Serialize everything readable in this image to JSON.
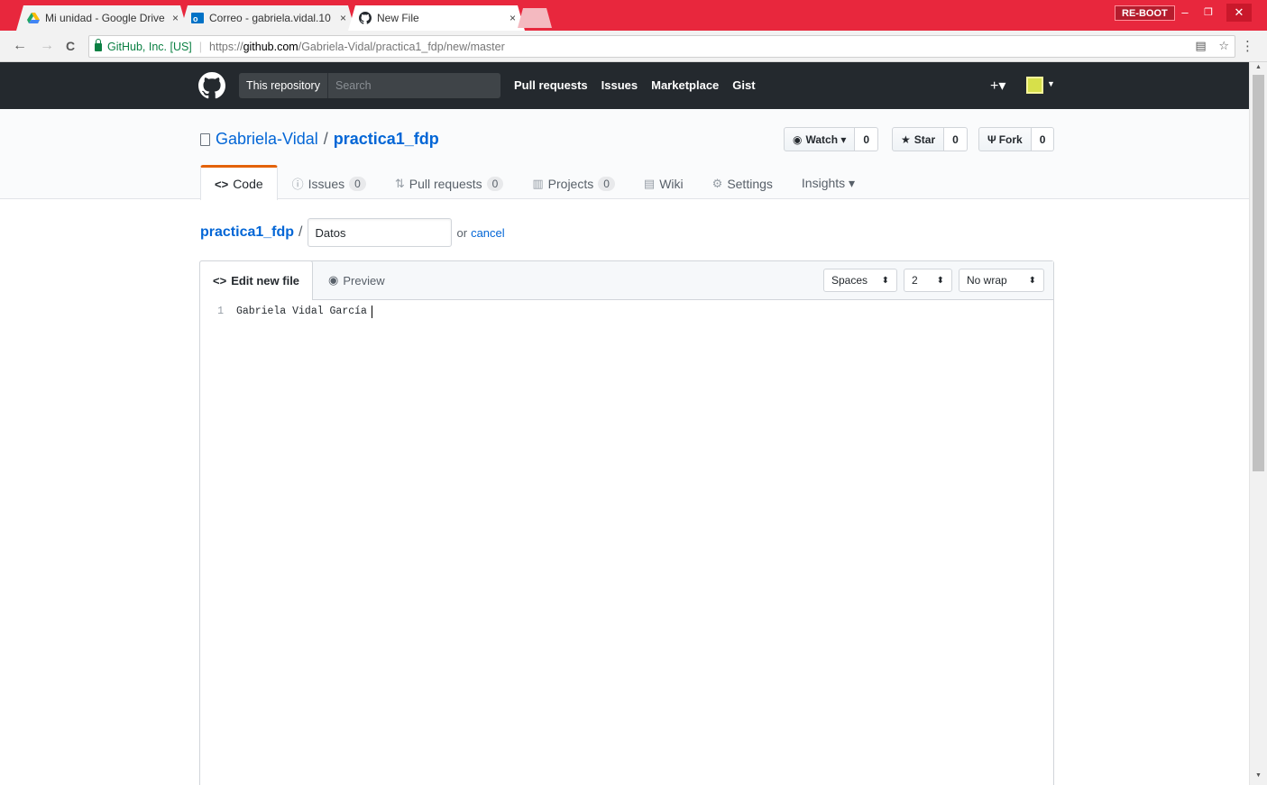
{
  "browser": {
    "tabs": [
      {
        "title": "Mi unidad - Google Drive",
        "close": "×",
        "icon": "google-drive-icon"
      },
      {
        "title": "Correo - gabriela.vidal.10",
        "close": "×",
        "icon": "outlook-icon"
      },
      {
        "title": "New File",
        "close": "×",
        "icon": "github-icon"
      }
    ],
    "profile_label": "RE-BOOT",
    "window_controls": {
      "minimize": "–",
      "restore": "❐",
      "close": "✕"
    },
    "nav": {
      "back": "←",
      "forward": "→",
      "reload": "C"
    },
    "address": {
      "origin": "GitHub, Inc. [US]",
      "separator": "|",
      "scheme": "https://",
      "host": "github.com",
      "path": "/Gabriela-Vidal/practica1_fdp/new/master"
    },
    "omnibox_icons": {
      "translate": "▤",
      "star": "☆"
    },
    "menu": "⋮"
  },
  "gh_header": {
    "search_scope": "This repository",
    "search_placeholder": "Search",
    "nav": [
      "Pull requests",
      "Issues",
      "Marketplace",
      "Gist"
    ],
    "plus": "+▾"
  },
  "repo": {
    "owner": "Gabriela-Vidal",
    "separator": "/",
    "name": "practica1_fdp",
    "actions": {
      "watch_label": "Watch ▾",
      "watch_count": "0",
      "star_label": "Star",
      "star_count": "0",
      "fork_label": "Fork",
      "fork_count": "0"
    },
    "tabs": [
      {
        "icon": "<>",
        "label": "Code",
        "count": ""
      },
      {
        "icon": "ⓘ",
        "label": "Issues",
        "count": "0"
      },
      {
        "icon": "⇅",
        "label": "Pull requests",
        "count": "0"
      },
      {
        "icon": "▥",
        "label": "Projects",
        "count": "0"
      },
      {
        "icon": "▤",
        "label": "Wiki",
        "count": ""
      },
      {
        "icon": "⚙",
        "label": "Settings",
        "count": ""
      },
      {
        "icon": "",
        "label": "Insights ▾",
        "count": ""
      }
    ]
  },
  "breadcrumb": {
    "repo": "practica1_fdp",
    "separator": "/",
    "filename_value": "Datos",
    "or_text": "or",
    "cancel": "cancel"
  },
  "editor": {
    "tab_edit": "Edit new file",
    "tab_edit_icon": "<>",
    "tab_preview": "Preview",
    "tab_preview_icon": "◉",
    "indent_mode": "Spaces",
    "indent_size": "2",
    "wrap_mode": "No wrap",
    "lines": [
      {
        "number": "1",
        "text": "Gabriela Vidal García"
      }
    ]
  },
  "colors": {
    "browser_titlebar": "#e8273d",
    "gh_header": "#24292e",
    "link": "#0366d6",
    "active_tab_accent": "#e36209"
  }
}
